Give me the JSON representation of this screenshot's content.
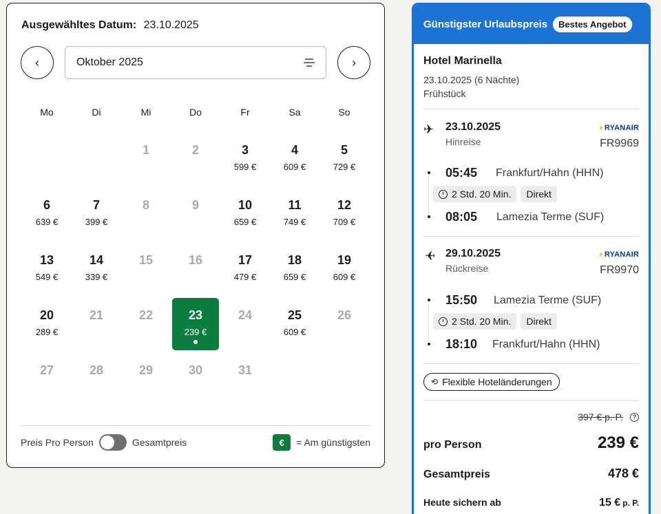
{
  "calendar": {
    "selected_label": "Ausgewähltes Datum:",
    "selected_value": "23.10.2025",
    "prev_icon": "chevron-left-icon",
    "next_icon": "chevron-right-icon",
    "month": "Oktober 2025",
    "weekdays": [
      "Mo",
      "Di",
      "Mi",
      "Do",
      "Fr",
      "Sa",
      "So"
    ],
    "leading_blanks": 2,
    "days": [
      {
        "day": "1",
        "price": null
      },
      {
        "day": "2",
        "price": null
      },
      {
        "day": "3",
        "price": "599 €"
      },
      {
        "day": "4",
        "price": "609 €"
      },
      {
        "day": "5",
        "price": "729 €"
      },
      {
        "day": "6",
        "price": "639 €"
      },
      {
        "day": "7",
        "price": "399 €"
      },
      {
        "day": "8",
        "price": null
      },
      {
        "day": "9",
        "price": null
      },
      {
        "day": "10",
        "price": "659 €"
      },
      {
        "day": "11",
        "price": "749 €"
      },
      {
        "day": "12",
        "price": "709 €"
      },
      {
        "day": "13",
        "price": "549 €"
      },
      {
        "day": "14",
        "price": "339 €"
      },
      {
        "day": "15",
        "price": null
      },
      {
        "day": "16",
        "price": null
      },
      {
        "day": "17",
        "price": "479 €"
      },
      {
        "day": "18",
        "price": "659 €"
      },
      {
        "day": "19",
        "price": "609 €"
      },
      {
        "day": "20",
        "price": "289 €"
      },
      {
        "day": "21",
        "price": null
      },
      {
        "day": "22",
        "price": null
      },
      {
        "day": "23",
        "price": "239 €",
        "selected": true
      },
      {
        "day": "24",
        "price": null
      },
      {
        "day": "25",
        "price": "609 €"
      },
      {
        "day": "26",
        "price": null
      },
      {
        "day": "27",
        "price": null
      },
      {
        "day": "28",
        "price": null
      },
      {
        "day": "29",
        "price": null
      },
      {
        "day": "30",
        "price": null
      },
      {
        "day": "31",
        "price": null
      }
    ],
    "toggle_left": "Preis Pro Person",
    "toggle_right": "Gesamtpreis",
    "legend_badge": "€",
    "legend_text": "= Am günstigsten",
    "colors": {
      "selected": "#0a7d3f",
      "muted_text": "#a9a9a9"
    }
  },
  "offer": {
    "title": "Günstigster Urlaubspreis",
    "badge": "Bestes Angebot",
    "hotel_name": "Hotel Marinella",
    "hotel_dates": "23.10.2025 (6 Nächte)",
    "board": "Frühstück",
    "outbound": {
      "icon": "plane-departure-icon",
      "date": "23.10.2025",
      "direction": "Hinreise",
      "airline": "RYANAIR",
      "flight_no": "FR9969",
      "dep_time": "05:45",
      "dep_place": "Frankfurt/Hahn (HHN)",
      "duration": "2 Std. 20 Min.",
      "stops": "Direkt",
      "arr_time": "08:05",
      "arr_place": "Lamezia Terme (SUF)"
    },
    "inbound": {
      "icon": "plane-return-icon",
      "date": "29.10.2025",
      "direction": "Rückreise",
      "airline": "RYANAIR",
      "flight_no": "FR9970",
      "dep_time": "15:50",
      "dep_place": "Lamezia Terme (SUF)",
      "duration": "2 Std. 20 Min.",
      "stops": "Direkt",
      "arr_time": "18:10",
      "arr_place": "Frankfurt/Hahn (HHN)"
    },
    "flex_label": "Flexible Hoteländerungen",
    "old_price": "397 € p. P.",
    "help_icon": "question-icon",
    "pp_label": "pro Person",
    "pp_value": "239 €",
    "total_label": "Gesamtpreis",
    "total_value": "478 €",
    "today_label": "Heute sichern ab",
    "today_value": "15 €",
    "today_unit": "p. P.",
    "colors": {
      "accent": "#1d73d3",
      "airline": "#073590"
    }
  }
}
